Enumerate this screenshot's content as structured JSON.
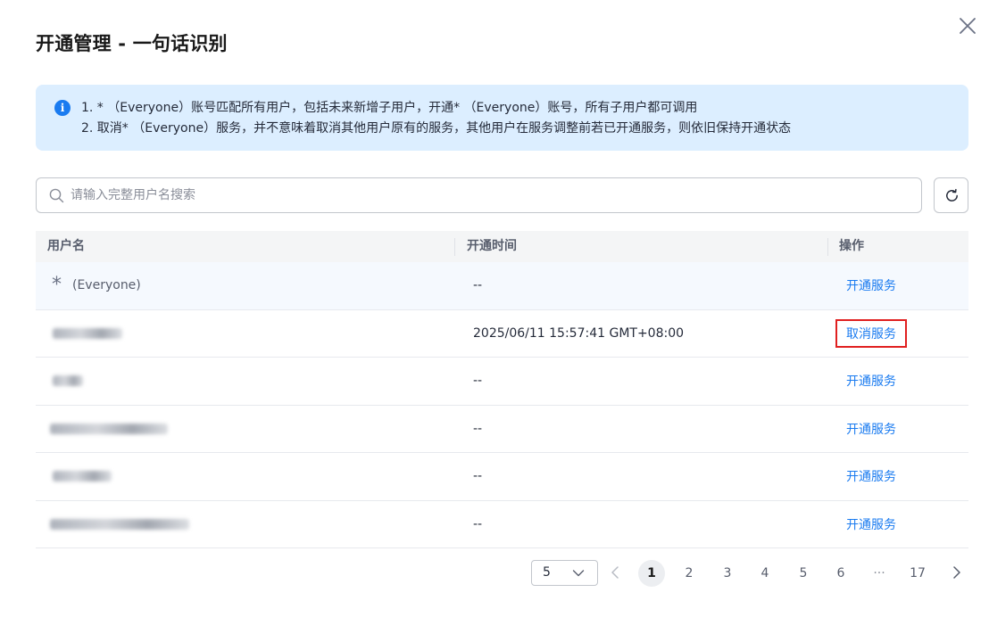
{
  "dialog": {
    "title": "开通管理 - 一句话识别",
    "close_icon": "close-icon"
  },
  "notice": {
    "icon": "info-icon",
    "line1": "1. * （Everyone）账号匹配所有用户，包括未来新增子用户，开通* （Everyone）账号，所有子用户都可调用",
    "line2": "2. 取消* （Everyone）服务，并不意味着取消其他用户原有的服务，其他用户在服务调整前若已开通服务，则依旧保持开通状态"
  },
  "search": {
    "placeholder": "请输入完整用户名搜索",
    "value": ""
  },
  "table": {
    "headers": {
      "user": "用户名",
      "time": "开通时间",
      "op": "操作"
    },
    "rows": [
      {
        "star": "*",
        "user": "(Everyone)",
        "time": "--",
        "op": "开通服务",
        "highlight": true
      },
      {
        "user": "",
        "time": "2025/06/11 15:57:41 GMT+08:00",
        "op": "取消服务",
        "marked": true
      },
      {
        "user": "",
        "time": "--",
        "op": "开通服务"
      },
      {
        "user": "",
        "time": "--",
        "op": "开通服务"
      },
      {
        "user": "",
        "time": "--",
        "op": "开通服务"
      },
      {
        "user": "",
        "time": "--",
        "op": "开通服务"
      }
    ]
  },
  "pagination": {
    "page_size": "5",
    "pages": [
      "1",
      "2",
      "3",
      "4",
      "5",
      "6",
      "···",
      "17"
    ],
    "current": "1"
  },
  "colors": {
    "accent": "#1a7bf0",
    "notice_bg": "#dceeff",
    "mark_red": "#e02020"
  }
}
